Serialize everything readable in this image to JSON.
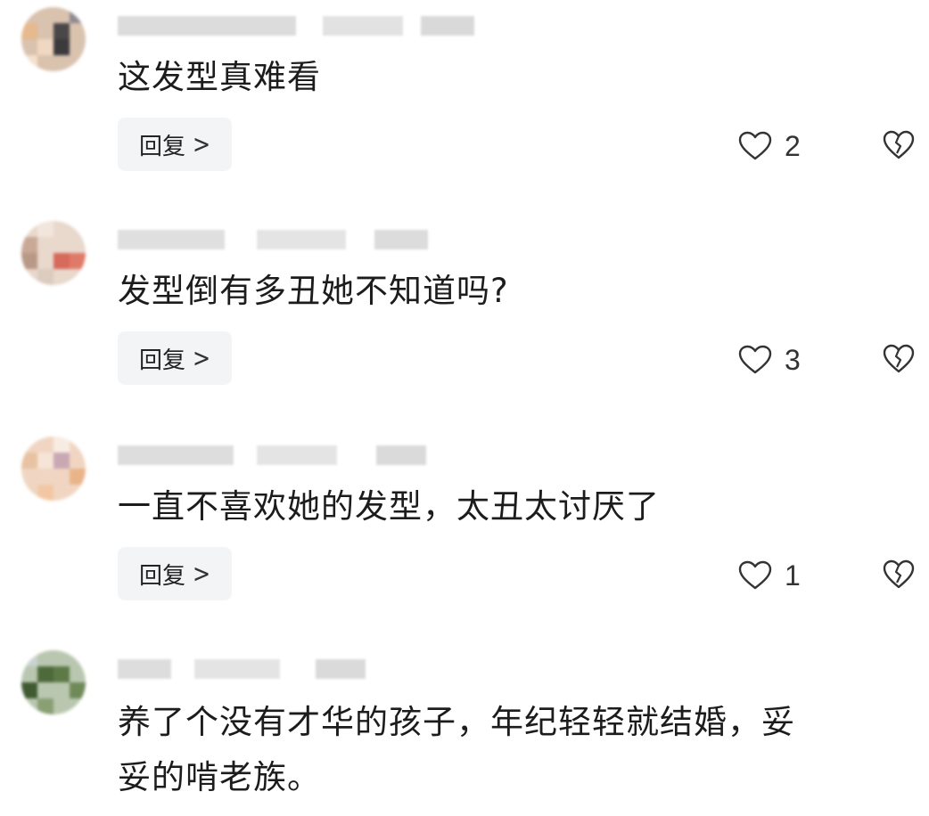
{
  "reply_label": "回复",
  "chevron_glyph": ">",
  "comments": [
    {
      "text": "这发型真难看",
      "likes": "2"
    },
    {
      "text": "发型倒有多丑她不知道吗?",
      "likes": "3"
    },
    {
      "text": "一直不喜欢她的发型，太丑太讨厌了",
      "likes": "1"
    },
    {
      "text": "养了个没有才华的孩子，年纪轻轻就结婚，妥\n妥的啃老族。"
    }
  ],
  "colors": {
    "reply_bg": "#f3f4f6",
    "icon_stroke": "#333333"
  },
  "icons": {
    "like": "heart-outline-icon",
    "dislike": "broken-heart-icon",
    "reply_chevron": "chevron-right-icon"
  }
}
